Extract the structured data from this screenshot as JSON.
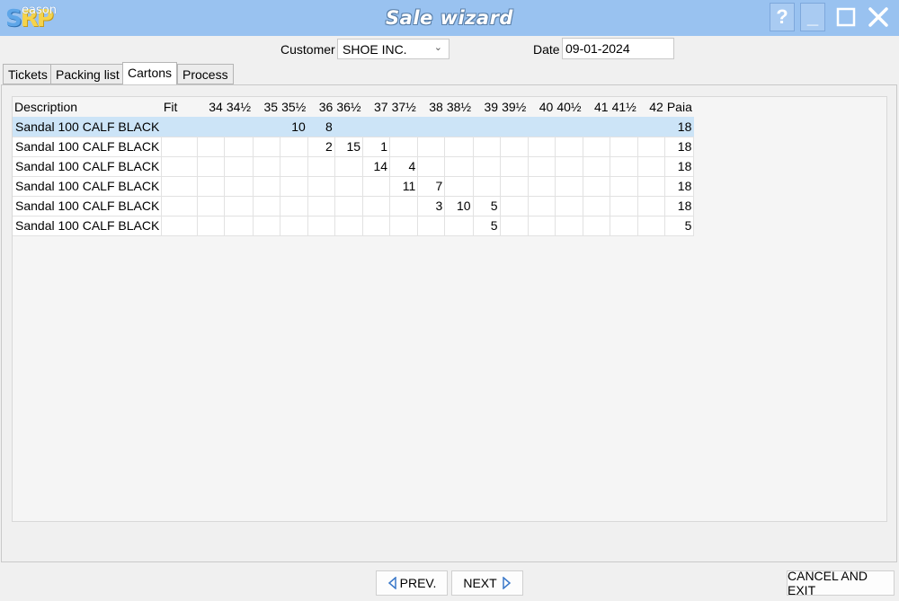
{
  "window": {
    "title": "Sale wizard",
    "logo_big": "SRP",
    "logo_small": "eason",
    "controls": {
      "help": "?",
      "minimize": "_",
      "maximize": "☐",
      "close": "✕"
    }
  },
  "header": {
    "customer_label": "Customer",
    "customer_value": "SHOE INC.",
    "date_label": "Date",
    "date_value": "09-01-2024"
  },
  "tabs": [
    {
      "label": "Tickets",
      "active": false
    },
    {
      "label": "Packing list",
      "active": false
    },
    {
      "label": "Cartons",
      "active": true
    },
    {
      "label": "Process",
      "active": false
    }
  ],
  "grid": {
    "columns": [
      "Description",
      "Fit",
      "34",
      "34½",
      "35",
      "35½",
      "36",
      "36½",
      "37",
      "37½",
      "38",
      "38½",
      "39",
      "39½",
      "40",
      "40½",
      "41",
      "41½",
      "42",
      "Paia"
    ],
    "rows": [
      {
        "selected": true,
        "cells": [
          "Sandal 100 CALF BLACK",
          "",
          "",
          "",
          "",
          "10",
          "8",
          "",
          "",
          "",
          "",
          "",
          "",
          "",
          "",
          "",
          "",
          "",
          "",
          "18"
        ]
      },
      {
        "selected": false,
        "cells": [
          "Sandal 100 CALF BLACK",
          "",
          "",
          "",
          "",
          "",
          "2",
          "15",
          "1",
          "",
          "",
          "",
          "",
          "",
          "",
          "",
          "",
          "",
          "",
          "18"
        ]
      },
      {
        "selected": false,
        "cells": [
          "Sandal 100 CALF BLACK",
          "",
          "",
          "",
          "",
          "",
          "",
          "",
          "14",
          "4",
          "",
          "",
          "",
          "",
          "",
          "",
          "",
          "",
          "",
          "18"
        ]
      },
      {
        "selected": false,
        "cells": [
          "Sandal 100 CALF BLACK",
          "",
          "",
          "",
          "",
          "",
          "",
          "",
          "",
          "11",
          "7",
          "",
          "",
          "",
          "",
          "",
          "",
          "",
          "",
          "18"
        ]
      },
      {
        "selected": false,
        "cells": [
          "Sandal 100 CALF BLACK",
          "",
          "",
          "",
          "",
          "",
          "",
          "",
          "",
          "",
          "3",
          "10",
          "5",
          "",
          "",
          "",
          "",
          "",
          "",
          "18"
        ]
      },
      {
        "selected": false,
        "cells": [
          "Sandal 100 CALF BLACK",
          "",
          "",
          "",
          "",
          "",
          "",
          "",
          "",
          "",
          "",
          "",
          "5",
          "",
          "",
          "",
          "",
          "",
          "",
          "5"
        ]
      }
    ]
  },
  "footer": {
    "prev_label": "PREV.",
    "next_label": "NEXT",
    "cancel_label": "CANCEL AND EXIT"
  },
  "colors": {
    "titlebar": "#99c2f0",
    "selected_row": "#cce4f7",
    "arrow": "#3a78c9"
  }
}
